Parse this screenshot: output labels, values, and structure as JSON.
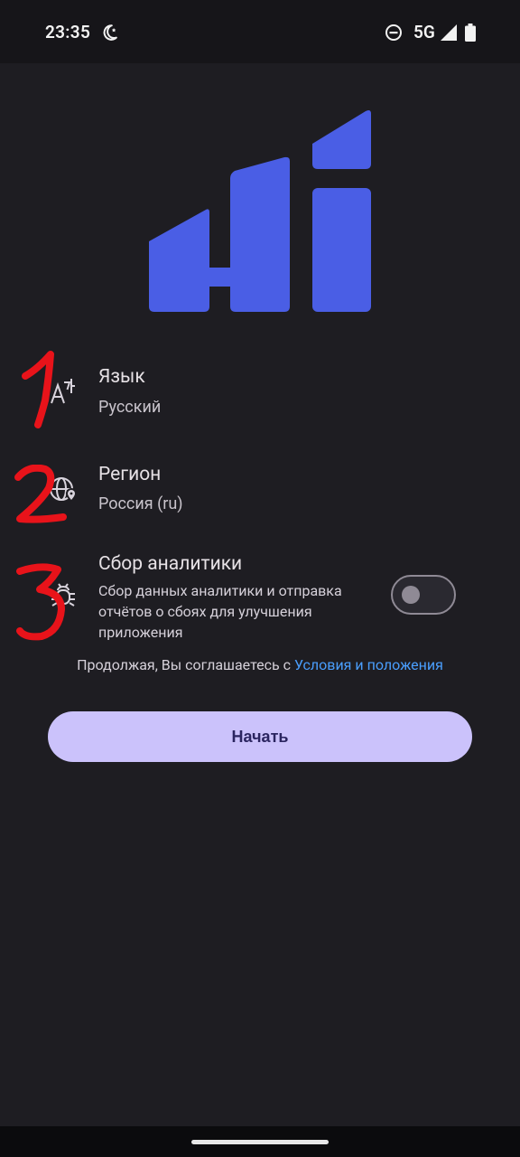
{
  "status_bar": {
    "time": "23:35",
    "network": "5G",
    "icons": [
      "moon-icon",
      "do-not-disturb-icon",
      "signal-icon",
      "battery-icon"
    ]
  },
  "logo": {
    "icon": "hi-logo",
    "color": "#4a5ee5"
  },
  "settings": {
    "language": {
      "title": "Язык",
      "value": "Русский",
      "icon": "translate-icon"
    },
    "region": {
      "title": "Регион",
      "value": "Россия (ru)",
      "icon": "globe-location-icon"
    },
    "analytics": {
      "title": "Сбор аналитики",
      "description": "Сбор данных аналитики и отправка отчётов о сбоях для улучшения приложения",
      "icon": "bug-icon",
      "enabled": false
    }
  },
  "annotations": [
    "1",
    "2",
    "3"
  ],
  "terms": {
    "prefix": "Продолжая, Вы соглашаетесь с ",
    "link": "Условия и положения"
  },
  "start_button": {
    "label": "Начать"
  },
  "colors": {
    "background": "#1e1d22",
    "accent": "#cbc2fb",
    "link": "#4a9fff",
    "annotation": "#e8131a"
  }
}
